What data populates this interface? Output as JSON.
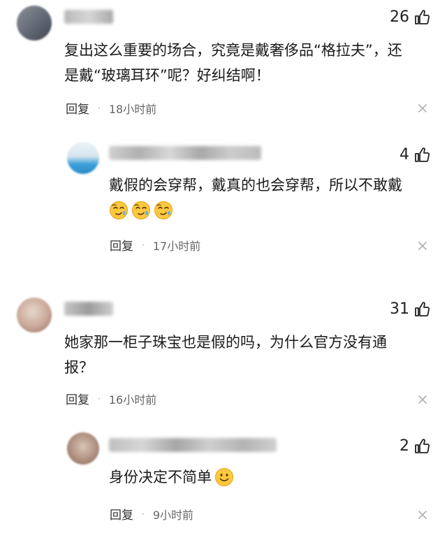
{
  "icons": {
    "like": "thumbs-up-icon",
    "close": "close-x-icon",
    "smirk_emoji": "smirk-face-emoji",
    "smile_emoji": "smile-face-emoji"
  },
  "colors": {
    "text": "#1a1a1a",
    "meta": "#666666",
    "like": "#222222",
    "close": "#b0b0b0"
  },
  "comments": [
    {
      "likes": "26",
      "text_line1": "复出这么重要的场合，究竟是戴奢侈品“格拉夫”，还",
      "text_line2": "是戴“玻璃耳环”呢？好纠结啊！",
      "reply_label": "回复",
      "dot": "·",
      "time": "18小时前"
    },
    {
      "likes": "4",
      "text_line1": "戴假的会穿帮，戴真的也会穿帮，所以不敢戴",
      "reply_label": "回复",
      "dot": "·",
      "time": "17小时前"
    },
    {
      "likes": "31",
      "text_line1": "她家那一柜子珠宝也是假的吗，为什么官方没有通",
      "text_line2": "报？",
      "reply_label": "回复",
      "dot": "·",
      "time": "16小时前"
    },
    {
      "likes": "2",
      "text_line1": "身份决定不简单",
      "reply_label": "回复",
      "dot": "·",
      "time": "9小时前"
    }
  ]
}
